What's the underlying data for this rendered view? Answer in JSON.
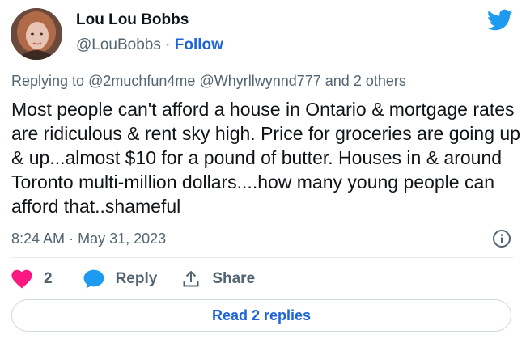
{
  "author": {
    "name": "Lou Lou Bobbs",
    "handle": "@LouBobbs",
    "separator": "·",
    "follow_label": "Follow"
  },
  "reply_context": {
    "prefix": "Replying to",
    "mentions": [
      "@2muchfun4me",
      "@Whyrllwynnd777"
    ],
    "suffix": "and 2 others"
  },
  "tweet": {
    "text": "Most people can't afford a house in Ontario & mortgage rates are ridiculous & rent sky high. Price for groceries are going up & up...almost $10 for a pound of butter. Houses in & around Toronto multi-million dollars....how many young people can afford that..shameful",
    "time": "8:24 AM",
    "separator": "·",
    "date": "May 31, 2023"
  },
  "actions": {
    "like_count": "2",
    "reply_label": "Reply",
    "share_label": "Share"
  },
  "read_replies_label": "Read 2 replies",
  "colors": {
    "twitter_blue": "#1d9bf0",
    "link_blue": "#1d64d8",
    "like_pink": "#f91880",
    "muted_text": "#536471"
  },
  "icons": {
    "logo": "twitter-bird-icon",
    "info": "info-circle-icon",
    "like": "heart-icon",
    "reply": "speech-bubble-icon",
    "share": "share-arrow-icon"
  }
}
